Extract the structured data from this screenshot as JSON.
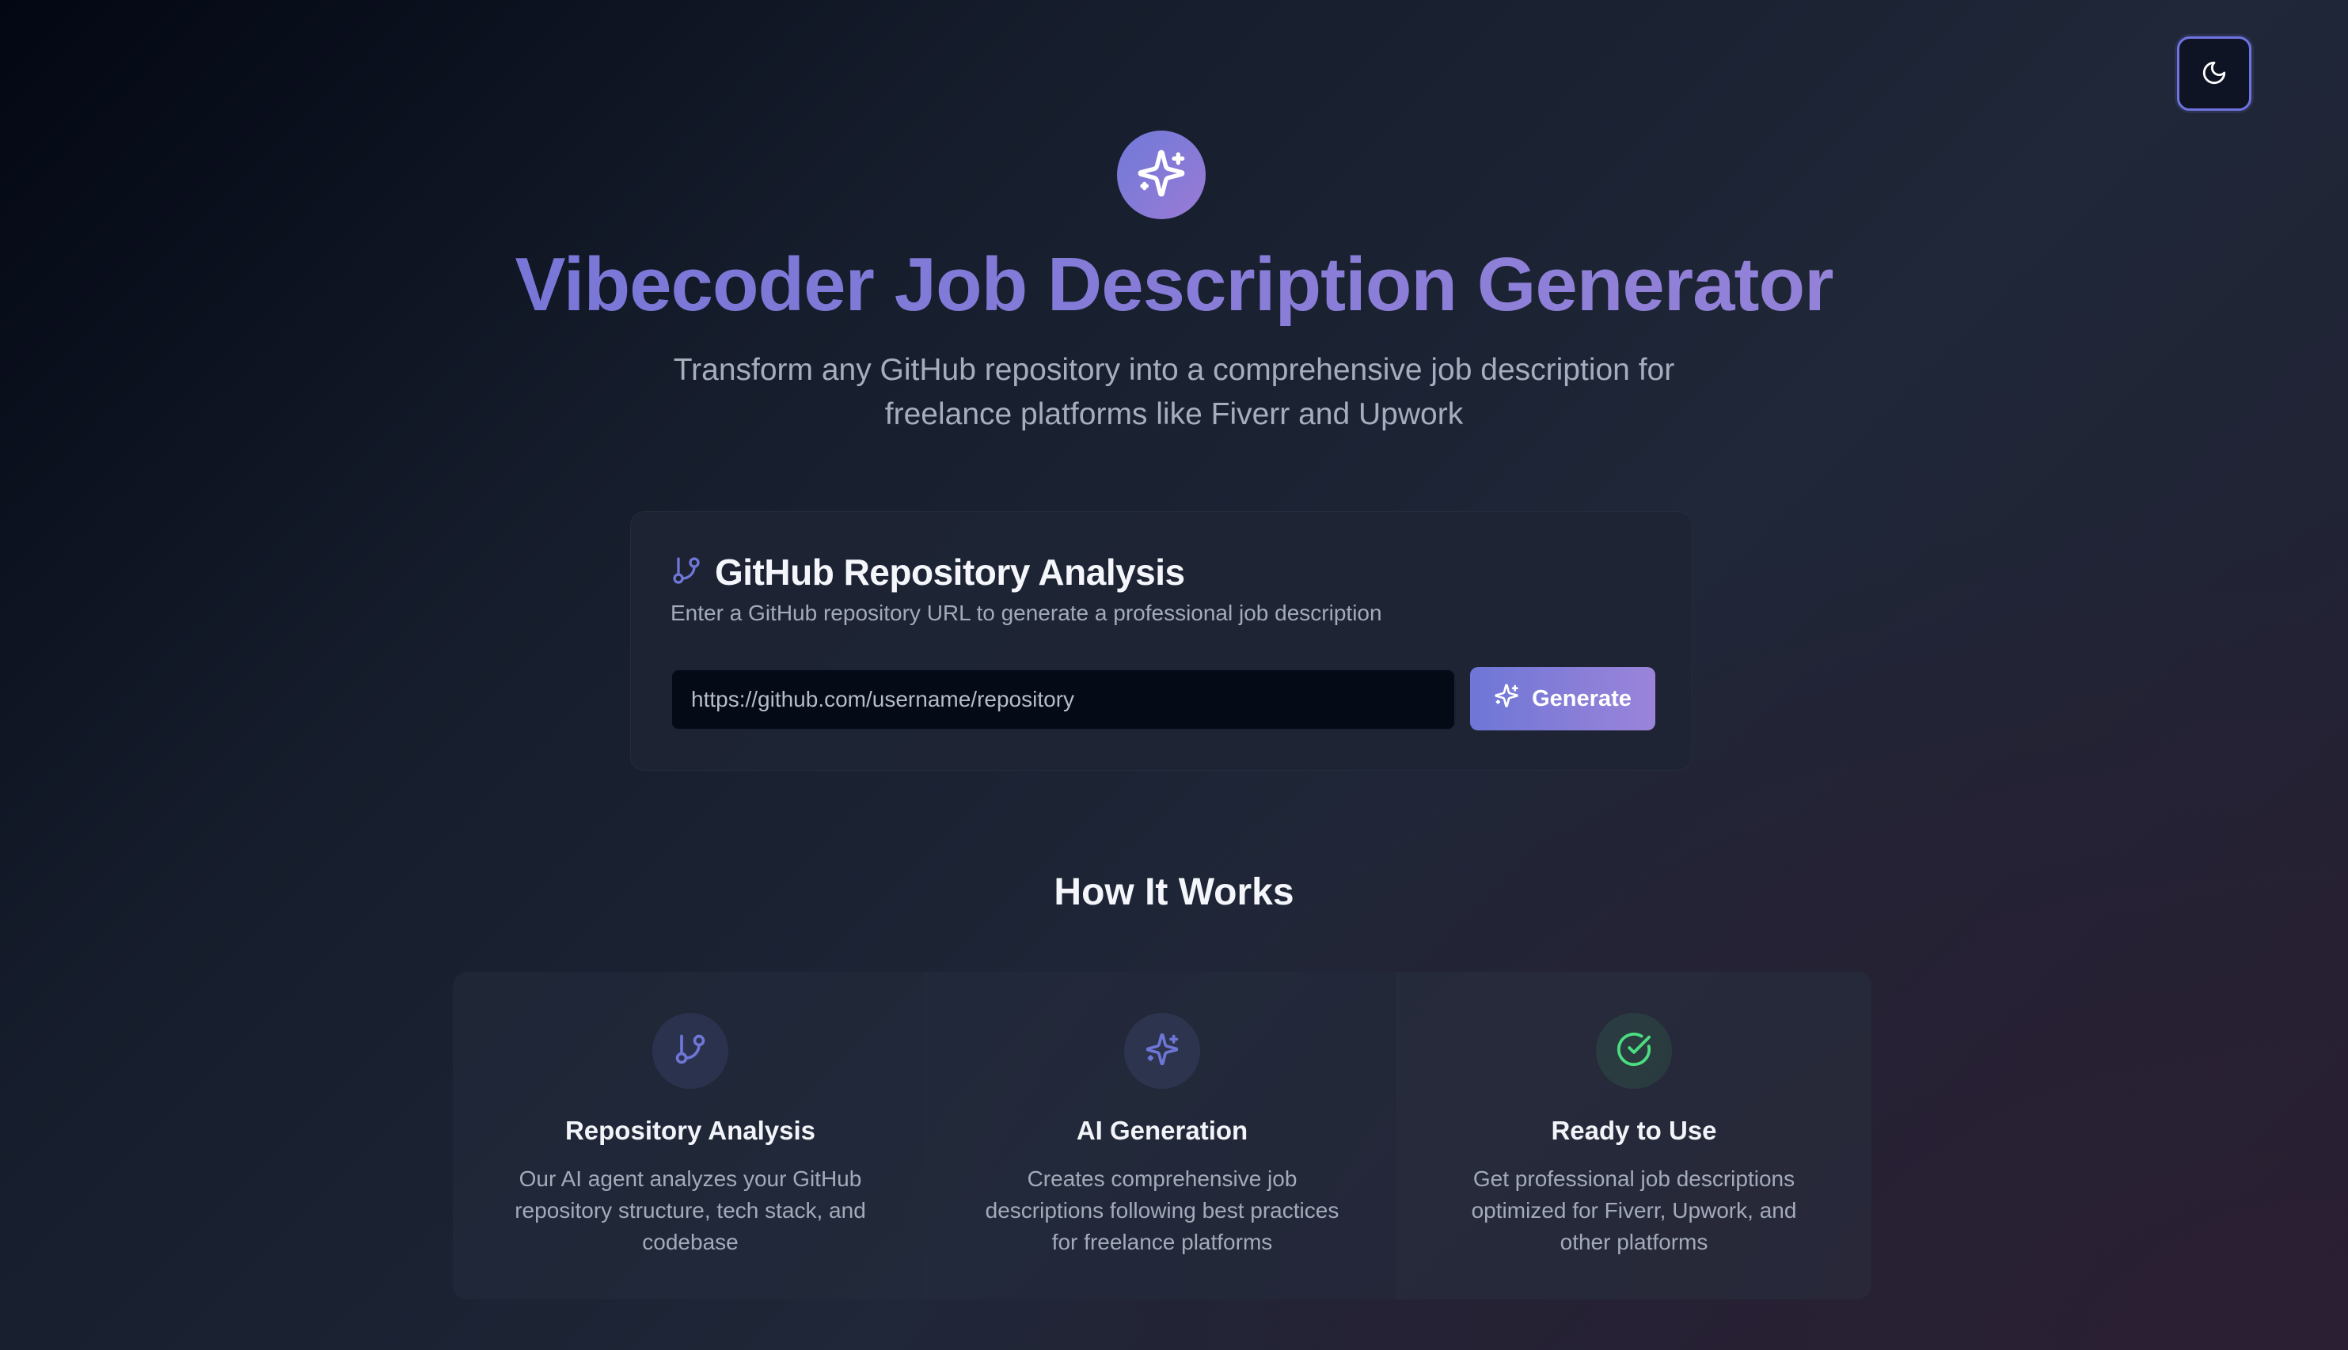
{
  "header": {
    "theme_toggle_icon": "moon-icon",
    "logo_icon": "sparkles-icon",
    "title": "Vibecoder Job Description Generator",
    "subtitle": "Transform any GitHub repository into a comprehensive job description for freelance platforms like Fiverr and Upwork"
  },
  "analysis_card": {
    "icon": "git-branch-icon",
    "title": "GitHub Repository Analysis",
    "description": "Enter a GitHub repository URL to generate a professional job description",
    "input_placeholder": "https://github.com/username/repository",
    "input_value": "",
    "generate_label": "Generate",
    "generate_icon": "sparkles-icon"
  },
  "how_it_works": {
    "title": "How It Works",
    "features": [
      {
        "icon": "git-branch-icon",
        "title": "Repository Analysis",
        "text": "Our AI agent analyzes your GitHub repository structure, tech stack, and codebase"
      },
      {
        "icon": "sparkles-icon",
        "title": "AI Generation",
        "text": "Creates comprehensive job descriptions following best practices for freelance platforms"
      },
      {
        "icon": "check-circle-icon",
        "title": "Ready to Use",
        "text": "Get professional job descriptions optimized for Fiverr, Upwork, and other platforms"
      }
    ]
  },
  "colors": {
    "accent": "#6e76d6",
    "accent_end": "#9b84da",
    "success": "#4ade80"
  }
}
